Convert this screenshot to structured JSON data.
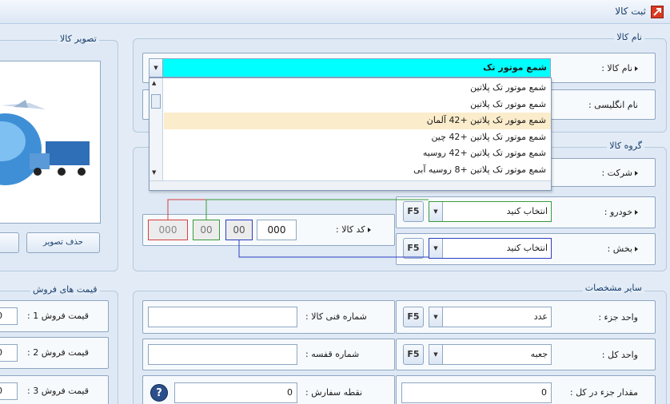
{
  "window": {
    "title": "ثبت کالا"
  },
  "product_name_group": {
    "legend": "نام کالا",
    "name_label": "نام کالا :",
    "name_value": "شمع موتور تک",
    "english_name_label": "نام انگلیسی :",
    "dropdown_items": [
      "شمع موتور تک پلاتین",
      "شمع موتور تک پلاتین",
      "شمع موتور تک پلاتین +42 آلمان",
      "شمع موتور تک پلاتین +42 چین",
      "شمع موتور تک پلاتین +42 روسیه",
      "شمع موتور تک پلاتین +8 روسیه آبی"
    ],
    "highlighted_index": 2
  },
  "product_group": {
    "legend": "گروه کالا",
    "company_label": "شرکت :",
    "vehicle_label": "خودرو :",
    "vehicle_value": "انتخاب کنید",
    "section_label": "بخش :",
    "section_value": "انتخاب کنید",
    "f5_label": "F5",
    "code_label": "کد کالا :",
    "code_values": [
      "000",
      "00",
      "00",
      "000"
    ]
  },
  "image_group": {
    "legend": "تصویر کالا",
    "delete_button": "حذف تصویر"
  },
  "sale_prices_group": {
    "legend": "قیمت های فروش",
    "items": [
      {
        "label": "قیمت فروش 1 :",
        "value": "0"
      },
      {
        "label": "قیمت فروش 2 :",
        "value": "0"
      },
      {
        "label": "قیمت فروش 3 :",
        "value": "0"
      }
    ]
  },
  "other_specs_group": {
    "legend": "سایر مشخصات",
    "tech_number_label": "شماره فنی کالا :",
    "tech_number_value": "",
    "shelf_number_label": "شماره قفسه :",
    "shelf_number_value": "",
    "reorder_label": "نقطه سفارش :",
    "reorder_value": "0",
    "part_unit_label": "واحد جزء :",
    "part_unit_value": "عدد",
    "whole_unit_label": "واحد کل :",
    "whole_unit_value": "جعبه",
    "qty_label": "مقدار جزء در کل :",
    "qty_value": "0",
    "f5_label": "F5",
    "help_label": "?"
  },
  "colors": {
    "name_input_bg": "#00ffff",
    "code_red": "#d44040",
    "code_green": "#3a9a3a",
    "code_blue": "#2a3fc0"
  }
}
